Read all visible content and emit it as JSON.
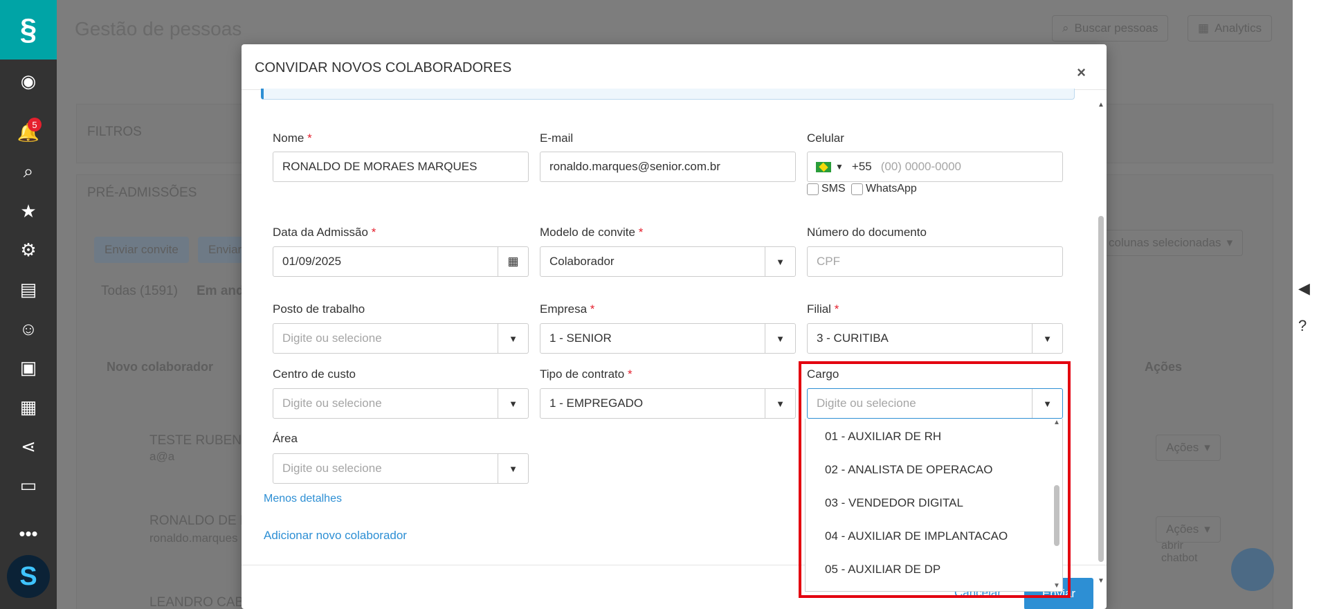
{
  "page": {
    "title": "Gestão de pessoas",
    "search_label": "Buscar pessoas",
    "analytics_label": "Analytics",
    "filters_label": "FILTROS",
    "pre_admissions_label": "PRÉ-ADMISSÕES",
    "send_invite_label": "Enviar convite",
    "send_label": "Enviar",
    "columns_label": "colunas selecionadas",
    "tab_all": "Todas (1591)",
    "tab_progress": "Em and",
    "col_new_employee": "Novo colaborador",
    "col_actions": "Ações",
    "row1_name": "TESTE RUBENS",
    "row1_email": "a@a",
    "row2_name": "RONALDO DE M",
    "row2_email": "ronaldo.marques",
    "row3_name": "LEANDRO CABE",
    "row_actions": "Ações",
    "chatbot_alt": "abrir chatbot",
    "notification_count": "5"
  },
  "modal": {
    "title": "CONVIDAR NOVOS COLABORADORES",
    "close": "×",
    "name_label": "Nome",
    "name_value": "RONALDO DE MORAES MARQUES",
    "email_label": "E-mail",
    "email_value": "ronaldo.marques@senior.com.br",
    "phone_label": "Celular",
    "phone_code": "+55",
    "phone_placeholder": "(00) 0000-0000",
    "sms_label": "SMS",
    "whatsapp_label": "WhatsApp",
    "admission_label": "Data da Admissão",
    "admission_value": "01/09/2025",
    "invite_model_label": "Modelo de convite",
    "invite_model_value": "Colaborador",
    "doc_number_label": "Número do documento",
    "doc_number_placeholder": "CPF",
    "workplace_label": "Posto de trabalho",
    "company_label": "Empresa",
    "company_value": "1 - SENIOR",
    "branch_label": "Filial",
    "branch_value": "3 - CURITIBA",
    "cost_center_label": "Centro de custo",
    "contract_type_label": "Tipo de contrato",
    "contract_type_value": "1 - EMPREGADO",
    "role_label": "Cargo",
    "area_label": "Área",
    "placeholder_select": "Digite ou selecione",
    "less_details": "Menos detalhes",
    "add_new": "Adicionar novo colaborador",
    "cancel": "Cancelar",
    "submit": "Enviar",
    "required_mark": "*"
  },
  "role_options": [
    "01 - AUXILIAR DE RH",
    "02 - ANALISTA DE OPERACAO",
    "03 - VENDEDOR DIGITAL",
    "04 - AUXILIAR DE IMPLANTACAO",
    "05 - AUXILIAR DE DP"
  ],
  "colors": {
    "accent": "#2d8fd4",
    "brand_teal": "#00a4a6",
    "highlight_red": "#e3000f",
    "required": "#e5202e"
  }
}
